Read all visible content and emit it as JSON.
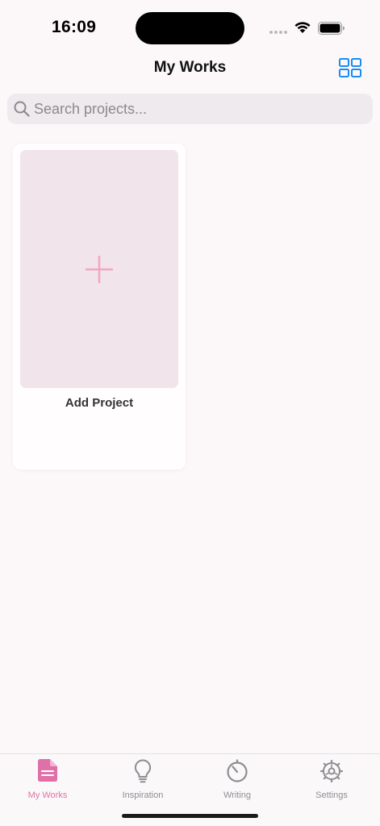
{
  "status_bar": {
    "time": "16:09"
  },
  "header": {
    "title": "My Works",
    "layout_toggle_icon": "grid-layout-icon"
  },
  "search": {
    "placeholder": "Search projects...",
    "value": "",
    "icon": "search-icon"
  },
  "projects": {
    "add_card": {
      "label": "Add Project",
      "icon": "plus-icon"
    }
  },
  "tabs": [
    {
      "label": "My Works",
      "icon": "document-icon",
      "active": true
    },
    {
      "label": "Inspiration",
      "icon": "lightbulb-icon",
      "active": false
    },
    {
      "label": "Writing",
      "icon": "timer-icon",
      "active": false
    },
    {
      "label": "Settings",
      "icon": "gear-icon",
      "active": false
    }
  ],
  "colors": {
    "accent": "#e070a8",
    "link_blue": "#1a8cf0",
    "background": "#fcf8fa",
    "card_thumb": "#f1e4ea",
    "plus": "#f2a7bd",
    "tab_inactive": "#8e8e93"
  }
}
